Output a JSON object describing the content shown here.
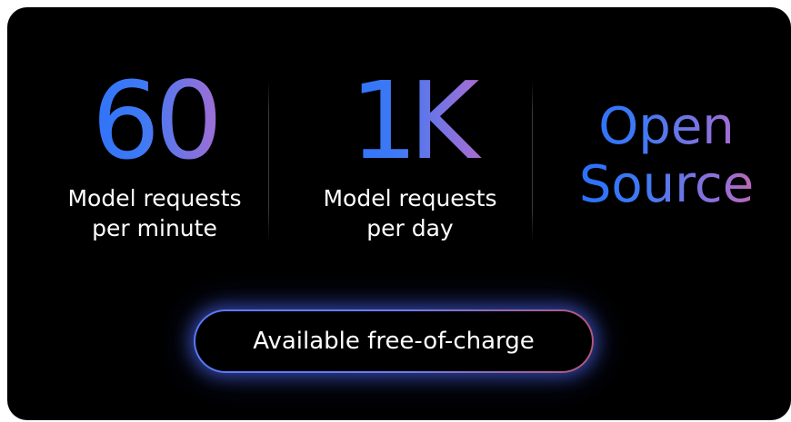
{
  "stats": [
    {
      "value": "60",
      "label_line1": "Model requests",
      "label_line2": "per minute"
    },
    {
      "value": "1K",
      "label_line1": "Model requests",
      "label_line2": "per day"
    }
  ],
  "open_source": {
    "line1": "Open",
    "line2": "Source"
  },
  "cta": {
    "label": "Available free-of-charge"
  },
  "colors": {
    "background": "#000000",
    "gradient_start": "#1f6bff",
    "gradient_mid": "#9a6fd6",
    "gradient_end": "#e0608e",
    "text": "#ffffff"
  }
}
